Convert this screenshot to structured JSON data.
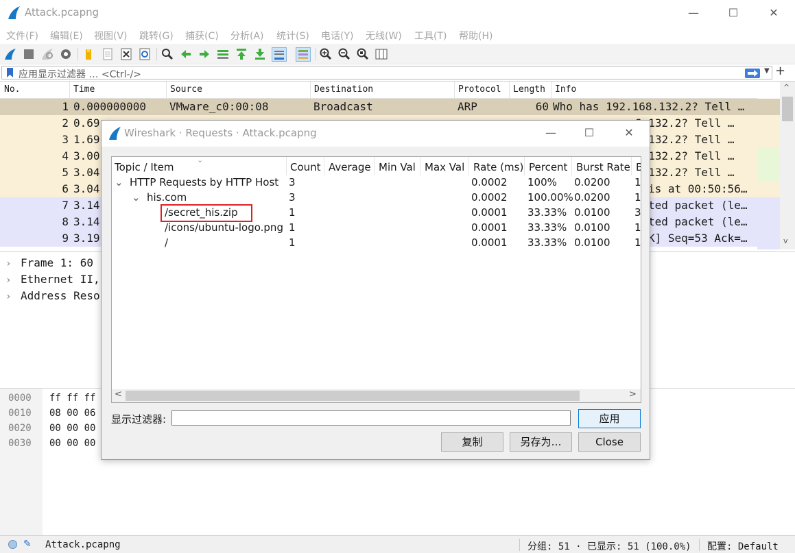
{
  "window": {
    "title": "Attack.pcapng",
    "minimize": "—",
    "maximize": "☐",
    "close": "✕"
  },
  "menu": [
    "文件(F)",
    "编辑(E)",
    "视图(V)",
    "跳转(G)",
    "捕获(C)",
    "分析(A)",
    "统计(S)",
    "电话(Y)",
    "无线(W)",
    "工具(T)",
    "帮助(H)"
  ],
  "toolbar_icons": [
    "shark-fin-start-icon",
    "stop-square-icon",
    "restart-fin-icon",
    "options-gear-icon",
    "open-folder-icon",
    "file-icon",
    "close-file-icon",
    "reload-icon",
    "find-magnifier-icon",
    "go-back-arrow-icon",
    "go-forward-arrow-icon",
    "go-to-packet-icon",
    "go-first-icon",
    "go-last-icon",
    "autoscroll-icon",
    "colorize-icon",
    "zoom-in-icon",
    "zoom-out-icon",
    "zoom-reset-icon",
    "resize-columns-icon"
  ],
  "filter": {
    "placeholder": "应用显示过滤器 … <Ctrl-/>",
    "add_label": "+"
  },
  "packet_list": {
    "columns": [
      "No.",
      "Time",
      "Source",
      "Destination",
      "Protocol",
      "Length",
      "Info"
    ],
    "rows": [
      {
        "no": "1",
        "time": "0.000000000",
        "source": "VMware_c0:00:08",
        "destination": "Broadcast",
        "protocol": "ARP",
        "length": "60",
        "info": "Who has 192.168.132.2? Tell …",
        "bg": "#d9cfb7",
        "selected": true
      },
      {
        "no": "2",
        "time": "0.69",
        "source": "",
        "destination": "",
        "protocol": "",
        "length": "",
        "info": "8.132.2? Tell …",
        "bg": "#faf0d7"
      },
      {
        "no": "3",
        "time": "1.69",
        "source": "",
        "destination": "",
        "protocol": "",
        "length": "",
        "info": "8.132.2? Tell …",
        "bg": "#faf0d7"
      },
      {
        "no": "4",
        "time": "3.00",
        "source": "",
        "destination": "",
        "protocol": "",
        "length": "",
        "info": "8.132.2? Tell …",
        "bg": "#faf0d7"
      },
      {
        "no": "5",
        "time": "3.04",
        "source": "",
        "destination": "",
        "protocol": "",
        "length": "",
        "info": "8.132.2? Tell …",
        "bg": "#faf0d7"
      },
      {
        "no": "6",
        "time": "3.04",
        "source": "",
        "destination": "",
        "protocol": "",
        "length": "",
        "info": "is at 00:50:56…",
        "bg": "#faf0d7"
      },
      {
        "no": "7",
        "time": "3.14",
        "source": "",
        "destination": "",
        "protocol": "",
        "length": "",
        "info": "ted packet (le…",
        "bg": "#e4e4fb"
      },
      {
        "no": "8",
        "time": "3.14",
        "source": "",
        "destination": "",
        "protocol": "",
        "length": "",
        "info": "ted packet (le…",
        "bg": "#e4e4fb"
      },
      {
        "no": "9",
        "time": "3.19",
        "source": "",
        "destination": "",
        "protocol": "",
        "length": "",
        "info": "K] Seq=53 Ack=…",
        "bg": "#e4e4fb"
      }
    ]
  },
  "details": [
    "Frame 1: 60",
    "Ethernet II,",
    "Address Reso"
  ],
  "bytes": [
    {
      "offset": "0000",
      "hex": "ff ff ff"
    },
    {
      "offset": "0010",
      "hex": "08 00 06"
    },
    {
      "offset": "0020",
      "hex": "00 00 00"
    },
    {
      "offset": "0030",
      "hex": "00 00 00"
    }
  ],
  "status": {
    "file": "Attack.pcapng",
    "packets": "分组: 51 · 已显示: 51 (100.0%)",
    "profile": "配置: Default"
  },
  "dialog": {
    "title": "Wireshark · Requests · Attack.pcapng",
    "columns": [
      "Topic / Item",
      "Count",
      "Average",
      "Min Val",
      "Max Val",
      "Rate (ms)",
      "Percent",
      "Burst Rate",
      "B"
    ],
    "rows": [
      {
        "indent": 0,
        "expander": "⌄",
        "item": "HTTP Requests by HTTP Host",
        "count": "3",
        "rate": "0.0002",
        "percent": "100%",
        "burst": "0.0200",
        "b": "1"
      },
      {
        "indent": 1,
        "expander": "⌄",
        "item": "his.com",
        "count": "3",
        "rate": "0.0002",
        "percent": "100.00%",
        "burst": "0.0200",
        "b": "1"
      },
      {
        "indent": 2,
        "expander": "",
        "item": "/secret_his.zip",
        "count": "1",
        "rate": "0.0001",
        "percent": "33.33%",
        "burst": "0.0100",
        "b": "3"
      },
      {
        "indent": 2,
        "expander": "",
        "item": "/icons/ubuntu-logo.png",
        "count": "1",
        "rate": "0.0001",
        "percent": "33.33%",
        "burst": "0.0100",
        "b": "1"
      },
      {
        "indent": 2,
        "expander": "",
        "item": "/",
        "count": "1",
        "rate": "0.0001",
        "percent": "33.33%",
        "burst": "0.0100",
        "b": "1"
      }
    ],
    "filter_label": "显示过滤器:",
    "filter_value": "",
    "apply_label": "应用",
    "copy_label": "复制",
    "saveas_label": "另存为…",
    "close_label": "Close"
  },
  "colors": {
    "highlight": "#e02020",
    "selected_row": "#d9cfb7",
    "arp_row": "#faf0d7",
    "tcp_row": "#e4e4fb"
  }
}
